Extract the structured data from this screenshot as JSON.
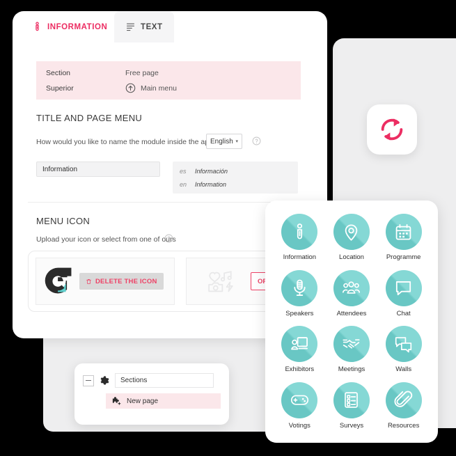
{
  "tabs": [
    {
      "label": "INFORMATION",
      "icon": "info-person-icon",
      "active": true
    },
    {
      "label": "TEXT",
      "icon": "text-lines-icon",
      "active": false
    }
  ],
  "breadcrumb": {
    "section_label": "Section",
    "section_value": "Free page",
    "superior_label": "Superior",
    "superior_value": "Main menu",
    "superior_icon": "arrow-up-circle-icon"
  },
  "title_section": {
    "heading": "TITLE AND PAGE MENU",
    "question": "How would you like to name the module inside the app?",
    "language_selected": "English",
    "language_caret": "▾",
    "help_icon": "help-circle-icon",
    "name_value": "Information",
    "name_placeholder": "Information",
    "translations": [
      {
        "code": "es",
        "value": "Información"
      },
      {
        "code": "en",
        "value": "Information"
      }
    ]
  },
  "menu_icon_section": {
    "heading": "MENU ICON",
    "subtitle": "Upload your icon or select from one of ours",
    "help_icon": "help-circle-icon",
    "current_icon": "app-logo-mark",
    "delete_label": "DELETE THE ICON",
    "delete_icon": "trash-icon",
    "placeholder_icon": "media-placeholder-icon",
    "or_select_label": "OR S"
  },
  "refresh_badge": {
    "icon": "refresh-sync-icon",
    "color": "#ec2d62"
  },
  "icon_picker": {
    "items": [
      {
        "label": "Information",
        "icon": "info-person-icon"
      },
      {
        "label": "Location",
        "icon": "map-pin-icon"
      },
      {
        "label": "Programme",
        "icon": "calendar-icon"
      },
      {
        "label": "Speakers",
        "icon": "microphone-icon"
      },
      {
        "label": "Attendees",
        "icon": "people-group-icon"
      },
      {
        "label": "Chat",
        "icon": "chat-bubble-icon"
      },
      {
        "label": "Exhibitors",
        "icon": "exhibitor-booth-icon"
      },
      {
        "label": "Meetings",
        "icon": "handshake-icon"
      },
      {
        "label": "Walls",
        "icon": "two-bubbles-icon"
      },
      {
        "label": "Votings",
        "icon": "gamepad-icon"
      },
      {
        "label": "Surveys",
        "icon": "checklist-icon"
      },
      {
        "label": "Resources",
        "icon": "paperclip-icon"
      }
    ]
  },
  "tree": {
    "collapse_icon": "collapse-minus-icon",
    "root_icon": "gear-icon",
    "root_value": "Sections",
    "child_icon": "puzzle-piece-icon",
    "child_label": "New page"
  },
  "colors": {
    "accent_pink": "#ec2d62",
    "teal": "#6ed0cd",
    "pink_band": "#fbe7ea",
    "panel_gray": "#eeeeef"
  }
}
